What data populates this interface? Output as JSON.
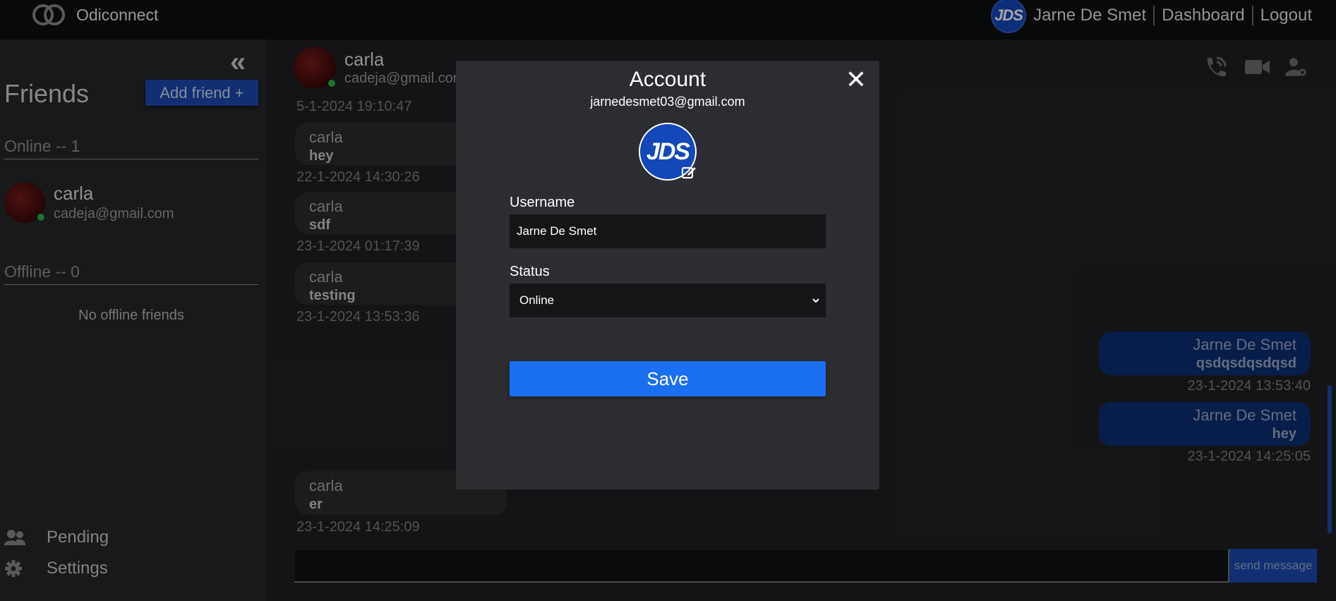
{
  "app": {
    "brand": "Odiconnect",
    "avatar_initials": "JDS",
    "user_name": "Jarne De Smet",
    "dashboard_link": "Dashboard",
    "logout_link": "Logout"
  },
  "sidebar": {
    "collapse_icon": "double-chevron-left-icon",
    "friends_title": "Friends",
    "add_friend_label": "Add friend +",
    "online_title": "Online -- 1",
    "offline_title": "Offline -- 0",
    "no_offline": "No offline friends",
    "friends": [
      {
        "name": "carla",
        "email": "cadeja@gmail.com",
        "status": "online"
      }
    ],
    "pending_label": "Pending",
    "settings_label": "Settings"
  },
  "chat": {
    "contact_name": "carla",
    "contact_email": "cadeja@gmail.com",
    "header_icons": [
      "phone-call-icon",
      "video-camera-icon",
      "user-settings-icon"
    ],
    "messages": [
      {
        "direction": "in",
        "user": "carla",
        "text": "",
        "time": "5-1-2024 19:10:47"
      },
      {
        "direction": "in",
        "user": "carla",
        "text": "hey",
        "time": "22-1-2024 14:30:26"
      },
      {
        "direction": "in",
        "user": "carla",
        "text": "sdf",
        "time": "23-1-2024 01:17:39"
      },
      {
        "direction": "in",
        "user": "carla",
        "text": "testing",
        "time": "23-1-2024 13:53:36"
      },
      {
        "direction": "out",
        "user": "Jarne De Smet",
        "text": "qsdqsdqsdqsd",
        "time": "23-1-2024 13:53:40"
      },
      {
        "direction": "out",
        "user": "Jarne De Smet",
        "text": "hey",
        "time": "23-1-2024 14:25:05"
      },
      {
        "direction": "in",
        "user": "carla",
        "text": "er",
        "time": "23-1-2024 14:25:09"
      }
    ],
    "composer_value": "",
    "send_label": "send message"
  },
  "modal": {
    "title": "Account",
    "email": "jarnedesmet03@gmail.com",
    "avatar_initials": "JDS",
    "username_label": "Username",
    "username_value": "Jarne De Smet",
    "status_label": "Status",
    "status_value": "Online",
    "save_label": "Save",
    "close_glyph": "✕"
  },
  "colors": {
    "accent": "#1a6ef0",
    "brand_blue": "#1b49b0",
    "online": "#2fb34a"
  }
}
